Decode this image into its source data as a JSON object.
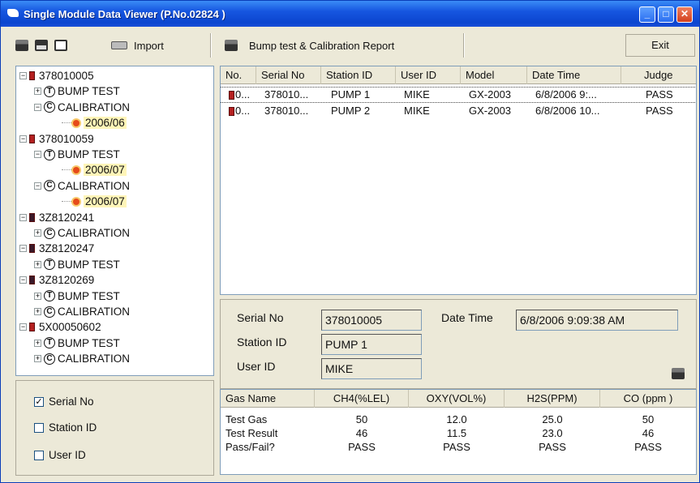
{
  "window": {
    "title": "Single Module Data Viewer (P.No.02824 )",
    "controls": {
      "minimize": "_",
      "maximize": "□",
      "close": "✕"
    }
  },
  "toolbar": {
    "import_label": "Import",
    "report_label": "Bump test & Calibration Report",
    "exit_label": "Exit"
  },
  "tree": [
    {
      "kind": "device",
      "label": "378010005",
      "expander": "−"
    },
    {
      "kind": "test",
      "badge": "T",
      "label": "BUMP TEST",
      "expander": "+"
    },
    {
      "kind": "test",
      "badge": "C",
      "label": "CALIBRATION",
      "expander": "−"
    },
    {
      "kind": "date",
      "label": "2006/06"
    },
    {
      "kind": "device",
      "label": "378010059",
      "expander": "−"
    },
    {
      "kind": "test",
      "badge": "T",
      "label": "BUMP TEST",
      "expander": "−"
    },
    {
      "kind": "date",
      "label": "2006/07"
    },
    {
      "kind": "test",
      "badge": "C",
      "label": "CALIBRATION",
      "expander": "−"
    },
    {
      "kind": "date",
      "label": "2006/07"
    },
    {
      "kind": "device",
      "label": "3Z8120241",
      "expander": "−",
      "dark": true
    },
    {
      "kind": "test",
      "badge": "C",
      "label": "CALIBRATION",
      "expander": "+"
    },
    {
      "kind": "device",
      "label": "3Z8120247",
      "expander": "−",
      "dark": true
    },
    {
      "kind": "test",
      "badge": "T",
      "label": "BUMP TEST",
      "expander": "+"
    },
    {
      "kind": "device",
      "label": "3Z8120269",
      "expander": "−",
      "dark": true
    },
    {
      "kind": "test",
      "badge": "T",
      "label": "BUMP TEST",
      "expander": "+"
    },
    {
      "kind": "test",
      "badge": "C",
      "label": "CALIBRATION",
      "expander": "+"
    },
    {
      "kind": "device",
      "label": "5X00050602",
      "expander": "−"
    },
    {
      "kind": "test",
      "badge": "T",
      "label": "BUMP TEST",
      "expander": "+"
    },
    {
      "kind": "test",
      "badge": "C",
      "label": "CALIBRATION",
      "expander": "+"
    }
  ],
  "filters": [
    {
      "label": "Serial No",
      "checked": true
    },
    {
      "label": "Station ID",
      "checked": false
    },
    {
      "label": "User ID",
      "checked": false
    }
  ],
  "list": {
    "columns": [
      "No.",
      "Serial No",
      "Station ID",
      "User ID",
      "Model",
      "Date Time",
      "Judge"
    ],
    "rows": [
      [
        "0...",
        "378010...",
        "PUMP 1",
        "MIKE",
        "GX-2003",
        "6/8/2006 9:...",
        "PASS"
      ],
      [
        "0...",
        "378010...",
        "PUMP 2",
        "MIKE",
        "GX-2003",
        "6/8/2006 10...",
        "PASS"
      ]
    ]
  },
  "detail": {
    "serial_label": "Serial No",
    "serial_value": "378010005",
    "station_label": "Station ID",
    "station_value": "PUMP 1",
    "user_label": "User ID",
    "user_value": "MIKE",
    "datetime_label": "Date Time",
    "datetime_value": "6/8/2006 9:09:38 AM"
  },
  "gas_table": {
    "headers": [
      "Gas Name",
      "CH4(%LEL)",
      "OXY(VOL%)",
      "H2S(PPM)",
      "CO (ppm )"
    ],
    "rows": [
      [
        "Test Gas",
        "50",
        "12.0",
        "25.0",
        "50"
      ],
      [
        "Test Result",
        "46",
        "11.5",
        "23.0",
        "46"
      ],
      [
        "Pass/Fail?",
        "PASS",
        "PASS",
        "PASS",
        "PASS"
      ]
    ]
  }
}
